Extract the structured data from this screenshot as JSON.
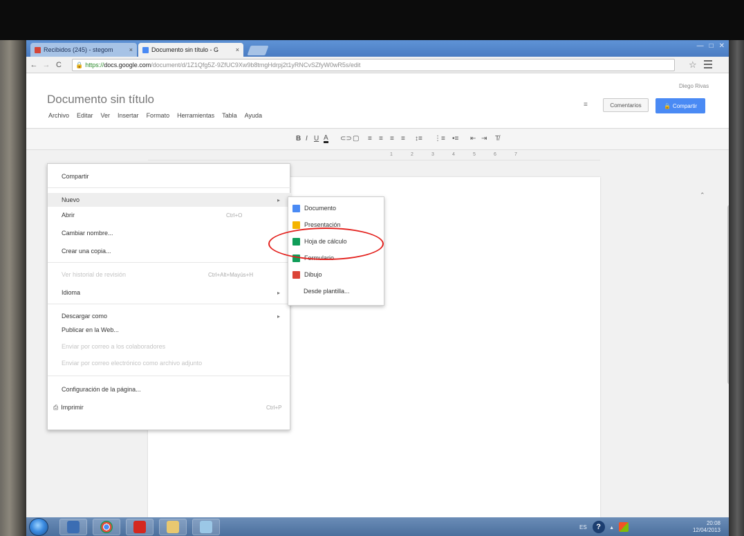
{
  "browser": {
    "tabs": [
      {
        "label": "Recibidos (245) - stegom",
        "favicon_color": "#d44638",
        "active": false
      },
      {
        "label": "Documento sin título - G",
        "favicon_color": "#4a8af4",
        "active": true
      }
    ],
    "url": {
      "scheme": "https://",
      "host": "docs.google.com",
      "path": "/document/d/1Z1Qfg5Z-9ZfUC9Xw9b8tmgHdrpj2t1yRNCvSZfyW0wR5s/edit"
    }
  },
  "doc": {
    "title": "Documento sin título",
    "menubar": [
      "Archivo",
      "Editar",
      "Ver",
      "Insertar",
      "Formato",
      "Herramientas",
      "Tabla",
      "Ayuda"
    ],
    "user_name": "Diego Rivas",
    "comments_label": "Comentarios",
    "share_label": "Compartir"
  },
  "file_menu": {
    "items": [
      {
        "label": "Compartir",
        "disabled": false
      },
      {
        "label": "Nuevo",
        "disabled": false,
        "submenu": true,
        "highlighted": true
      },
      {
        "label": "Abrir",
        "shortcut": "Ctrl+O",
        "disabled": false
      },
      {
        "label": "Cambiar nombre...",
        "disabled": false
      },
      {
        "label": "Crear una copia...",
        "disabled": false
      },
      {
        "label": "Ver historial de revisión",
        "shortcut": "Ctrl+Alt+Mayús+H",
        "disabled": true
      },
      {
        "label": "Idioma",
        "disabled": false,
        "submenu": true
      },
      {
        "label": "Descargar como",
        "disabled": false,
        "submenu": true
      },
      {
        "label": "Publicar en la Web...",
        "disabled": false
      },
      {
        "label": "Enviar por correo a los colaboradores",
        "disabled": true
      },
      {
        "label": "Enviar por correo electrónico como archivo adjunto",
        "disabled": true
      },
      {
        "label": "Configuración de la página...",
        "disabled": false
      },
      {
        "label": "Imprimir",
        "shortcut": "Ctrl+P",
        "disabled": false
      }
    ]
  },
  "new_submenu": {
    "items": [
      {
        "label": "Documento",
        "icon": "docs-icon",
        "color": "#4a8af4"
      },
      {
        "label": "Presentación",
        "icon": "slides-icon",
        "color": "#f4b400"
      },
      {
        "label": "Hoja de cálculo",
        "icon": "sheets-icon",
        "color": "#0f9d58"
      },
      {
        "label": "Formulario",
        "icon": "forms-icon",
        "color": "#0f9d58"
      },
      {
        "label": "Dibujo",
        "icon": "drawing-icon",
        "color": "#db4437"
      },
      {
        "label": "Desde plantilla...",
        "icon": "",
        "color": ""
      }
    ]
  },
  "taskbar": {
    "apps": [
      {
        "icon": "explorer-icon",
        "color": "#3b6db3"
      },
      {
        "icon": "chrome-icon",
        "color": "#e04a3a"
      },
      {
        "icon": "acrobat-icon",
        "color": "#d5281f"
      },
      {
        "icon": "folder-icon",
        "color": "#e8c870"
      },
      {
        "icon": "notepad-icon",
        "color": "#9bc7e6"
      }
    ],
    "clock_time": "20:08",
    "clock_date": "12/04/2013"
  }
}
